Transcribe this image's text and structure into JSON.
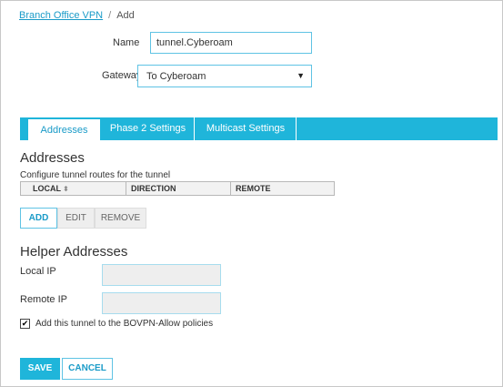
{
  "breadcrumb": {
    "parent": "Branch Office VPN",
    "separator": "/",
    "current": "Add"
  },
  "form": {
    "name_label": "Name",
    "name_value": "tunnel.Cyberoam",
    "gateway_label": "Gateway",
    "gateway_value": "To Cyberoam"
  },
  "tabs": [
    {
      "label": "Addresses",
      "active": true
    },
    {
      "label": "Phase 2 Settings",
      "active": false
    },
    {
      "label": "Multicast Settings",
      "active": false
    }
  ],
  "addresses": {
    "title": "Addresses",
    "description": "Configure tunnel routes for the tunnel",
    "columns": [
      "LOCAL",
      "DIRECTION",
      "REMOTE"
    ],
    "sort_column": "LOCAL",
    "add_label": "ADD",
    "edit_label": "EDIT",
    "remove_label": "REMOVE"
  },
  "helper": {
    "title": "Helper Addresses",
    "local_ip_label": "Local IP",
    "local_ip_value": "",
    "remote_ip_label": "Remote IP",
    "remote_ip_value": "",
    "checkbox_label": "Add this tunnel to the BOVPN-Allow policies",
    "checkbox_checked": true
  },
  "actions": {
    "save_label": "SAVE",
    "cancel_label": "CANCEL"
  },
  "colors": {
    "accent": "#1fb5da",
    "link": "#1a9bc8",
    "input_border": "#5fc3e4"
  },
  "icons": {
    "sort": "sort-icon",
    "dropdown": "chevron-down-icon",
    "checkmark": "check-icon"
  }
}
